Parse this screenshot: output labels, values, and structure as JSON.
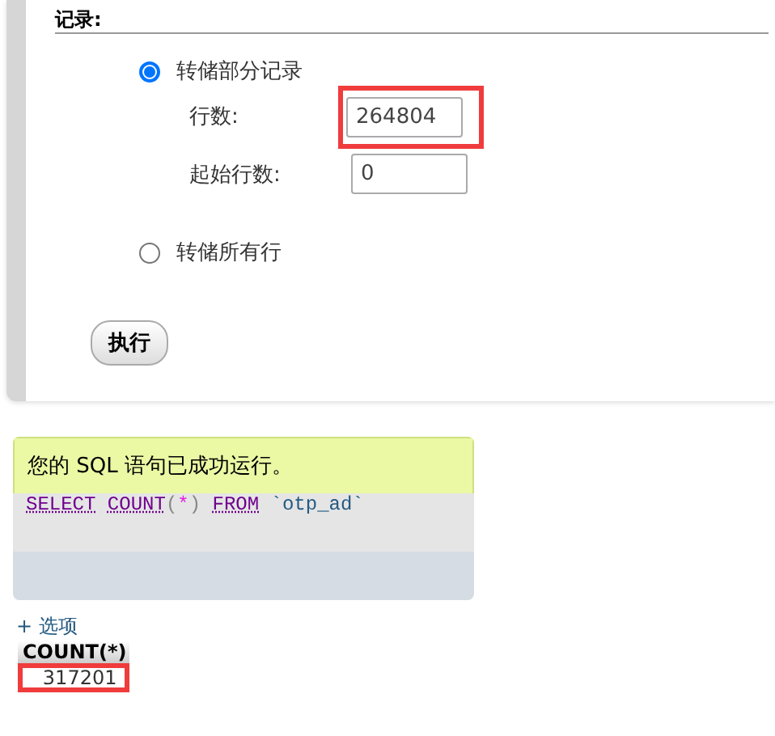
{
  "dump_options": {
    "legend": "记录:",
    "options": [
      {
        "label": "转储部分记录",
        "selected": true,
        "fields": [
          {
            "label": "行数:",
            "value": "264804",
            "highlighted": true
          },
          {
            "label": "起始行数:",
            "value": "0",
            "highlighted": false
          }
        ]
      },
      {
        "label": "转储所有行",
        "selected": false
      }
    ],
    "button": "执行"
  },
  "result": {
    "message": "您的 SQL 语句已成功运行。",
    "query": [
      {
        "text": "SELECT",
        "kind": "keyword"
      },
      {
        "text": "COUNT",
        "kind": "function"
      },
      {
        "text": "(",
        "kind": "paren"
      },
      {
        "text": "*",
        "kind": "star"
      },
      {
        "text": ")",
        "kind": "paren"
      },
      {
        "text": "FROM",
        "kind": "keyword"
      },
      {
        "text": "`otp_ad`",
        "kind": "name"
      }
    ],
    "options_link": "+ 选项",
    "table": {
      "columns": [
        "COUNT(*)"
      ],
      "rows": [
        {
          "cells": [
            "317201"
          ],
          "highlighted": true
        }
      ]
    }
  }
}
